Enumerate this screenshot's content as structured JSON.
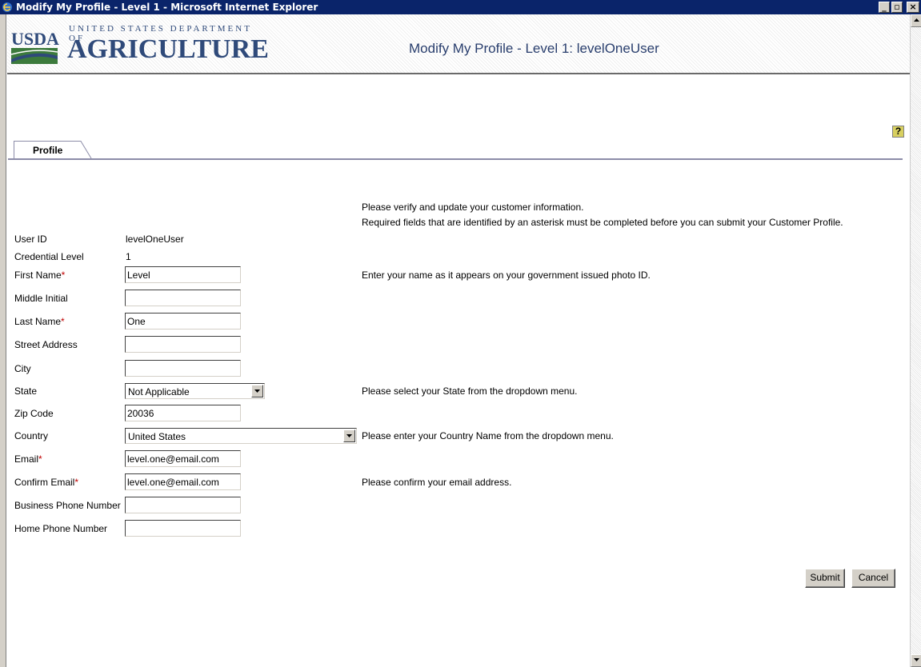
{
  "window": {
    "title": "Modify My Profile - Level 1 - Microsoft Internet Explorer",
    "minimize_glyph": "_",
    "maximize_glyph": "▫",
    "close_glyph": "×"
  },
  "header": {
    "logo_short": "USDA",
    "logo_dept": "UNITED STATES DEPARTMENT OF",
    "logo_name": "AGRICULTURE",
    "title": "Modify My Profile - Level 1: levelOneUser"
  },
  "help": {
    "icon": "help-icon",
    "glyph": "?"
  },
  "tabs": [
    {
      "label": "Profile",
      "active": true
    }
  ],
  "intro": {
    "line1": "Please verify and update your customer information.",
    "line2": "Required fields that are identified by an asterisk must be completed before you can submit your Customer Profile."
  },
  "form": {
    "user_id": {
      "label": "User ID",
      "value": "levelOneUser"
    },
    "credential_level": {
      "label": "Credential Level",
      "value": "1"
    },
    "first_name": {
      "label": "First Name",
      "required": "*",
      "value": "Level",
      "hint": "Enter your name as it appears on your government issued photo ID."
    },
    "middle_initial": {
      "label": "Middle Initial",
      "value": ""
    },
    "last_name": {
      "label": "Last Name",
      "required": "*",
      "value": "One"
    },
    "street_address": {
      "label": "Street Address",
      "value": ""
    },
    "city": {
      "label": "City",
      "value": ""
    },
    "state": {
      "label": "State",
      "value": "Not Applicable",
      "hint": "Please select your State from the dropdown menu."
    },
    "zip_code": {
      "label": "Zip Code",
      "value": "20036"
    },
    "country": {
      "label": "Country",
      "value": "United States",
      "hint": "Please enter your Country Name from the dropdown menu."
    },
    "email": {
      "label": "Email",
      "required": "*",
      "value": "level.one@email.com"
    },
    "confirm_email": {
      "label": "Confirm Email",
      "required": "*",
      "value": "level.one@email.com",
      "hint": "Please confirm your email address."
    },
    "business_phone": {
      "label": "Business Phone Number",
      "value": ""
    },
    "home_phone": {
      "label": "Home Phone Number",
      "value": ""
    }
  },
  "buttons": {
    "submit": "Submit",
    "cancel": "Cancel"
  },
  "colors": {
    "titlebar": "#0a246a",
    "header_text": "#2a3f6e",
    "required": "#c00000",
    "usda_blue": "#2f4a7a",
    "usda_green": "#3c7a3c"
  }
}
